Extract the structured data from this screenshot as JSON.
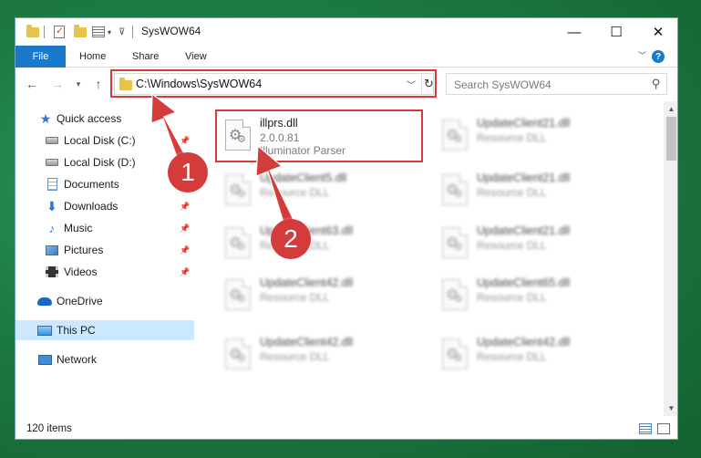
{
  "window": {
    "title": "SysWOW64",
    "controls": {
      "minimize": "—",
      "maximize": "☐",
      "close": "✕"
    }
  },
  "ribbon": {
    "tabs": [
      "File",
      "Home",
      "Share",
      "View"
    ],
    "help_label": "?"
  },
  "navigation": {
    "address": "C:\\Windows\\SysWOW64",
    "search_placeholder": "Search SysWOW64"
  },
  "sidebar": {
    "items": [
      {
        "label": "Quick access",
        "icon": "star-icon"
      },
      {
        "label": "Local Disk (C:)",
        "icon": "drive-icon",
        "pinned": true
      },
      {
        "label": "Local Disk (D:)",
        "icon": "drive-icon"
      },
      {
        "label": "Documents",
        "icon": "documents-icon",
        "pinned": true
      },
      {
        "label": "Downloads",
        "icon": "download-icon",
        "pinned": true
      },
      {
        "label": "Music",
        "icon": "music-icon",
        "pinned": true
      },
      {
        "label": "Pictures",
        "icon": "pictures-icon",
        "pinned": true
      },
      {
        "label": "Videos",
        "icon": "videos-icon",
        "pinned": true
      },
      {
        "label": "OneDrive",
        "icon": "onedrive-icon"
      },
      {
        "label": "This PC",
        "icon": "this-pc-icon",
        "selected": true
      },
      {
        "label": "Network",
        "icon": "network-icon"
      }
    ]
  },
  "files": [
    {
      "name": "illprs.dll",
      "version": "2.0.0.81",
      "description": "Illuminator Parser",
      "highlighted": true
    },
    {
      "name": "UpdateClient21.dll",
      "description": "Resource DLL"
    },
    {
      "name": "UpdateClient5.dll",
      "description": "Resource DLL"
    },
    {
      "name": "UpdateClient21.dll",
      "description": "Resource DLL"
    },
    {
      "name": "UpdateClient63.dll",
      "description": "Resource DLL"
    },
    {
      "name": "UpdateClient21.dll",
      "description": "Resource DLL"
    },
    {
      "name": "UpdateClient42.dll",
      "description": "Resource DLL"
    },
    {
      "name": "UpdateClient65.dll",
      "description": "Resource DLL"
    },
    {
      "name": "UpdateClient42.dll",
      "description": "Resource DLL"
    },
    {
      "name": "UpdateClient42.dll",
      "description": "Resource DLL"
    }
  ],
  "status": {
    "item_count": "120 items"
  },
  "callouts": [
    "1",
    "2"
  ],
  "colors": {
    "accent": "#1979ca",
    "highlight": "#d43b3b",
    "selected_bg": "#cce8ff"
  }
}
